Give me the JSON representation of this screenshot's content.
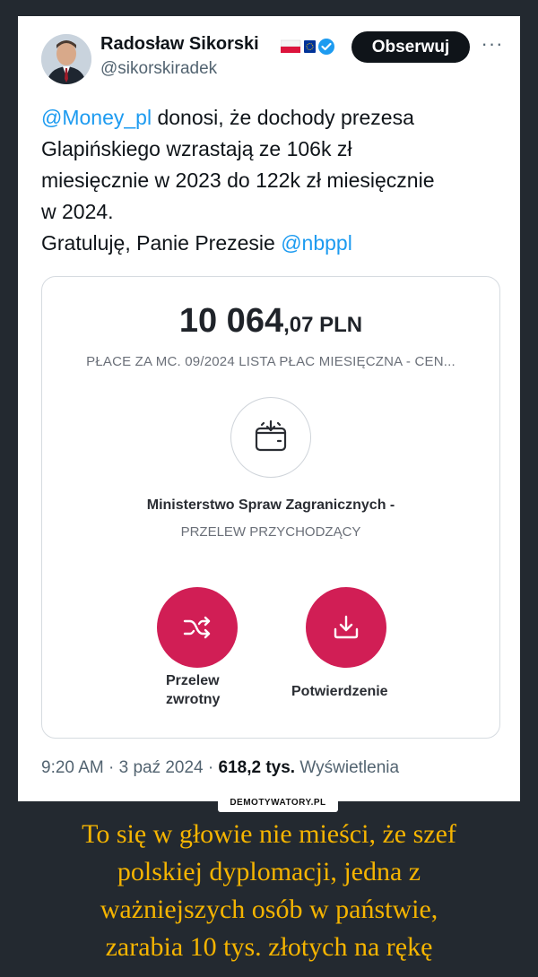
{
  "tweet": {
    "author_name": "Radosław Sikorski",
    "handle": "@sikorskiradek",
    "follow_label": "Obserwuj",
    "more_label": "···",
    "text": {
      "mention1": "@Money_pl",
      "line1_rest": " donosi, że dochody prezesa",
      "line2": "Glapińskiego wzrastają ze 106k zł",
      "line3": "miesięcznie w 2023 do 122k zł miesięcznie",
      "line4": "w 2024.",
      "line5": "Gratuluję, Panie Prezesie ",
      "mention2": "@nbppl"
    },
    "meta": {
      "time_date": "9:20 AM · 3 paź 2024 · ",
      "views_count": "618,2 tys.",
      "views_label": " Wyświetlenia"
    }
  },
  "card": {
    "amount_main": "10 064",
    "amount_fraction": ",07 PLN",
    "description": "PŁACE ZA MC. 09/2024 LISTA PŁAC MIESIĘCZNA - CEN...",
    "merchant": "Ministerstwo Spraw Zagranicznych -",
    "transfer_type": "PRZELEW PRZYCHODZĄCY",
    "actions": [
      {
        "label_line1": "Przelew",
        "label_line2": "zwrotny"
      },
      {
        "label_line1": "Potwierdzenie"
      }
    ]
  },
  "watermark": "DEMOTYWATORY.PL",
  "caption": {
    "line1": "To się w głowie nie mieści, że szef",
    "line2": "polskiej dyplomacji, jedna z",
    "line3": "ważniejszych osób w państwie,",
    "line4": "zarabia 10 tys. złotych na rękę"
  },
  "colors": {
    "background": "#232930",
    "caption": "#f5b400",
    "mention": "#1d9bf0",
    "action_button": "#d11e55",
    "verified": "#1d9bf0"
  },
  "icons": {
    "verified": "verified-badge-icon",
    "wallet": "wallet-download-icon",
    "return": "shuffle-return-icon",
    "confirm": "download-confirm-icon"
  }
}
